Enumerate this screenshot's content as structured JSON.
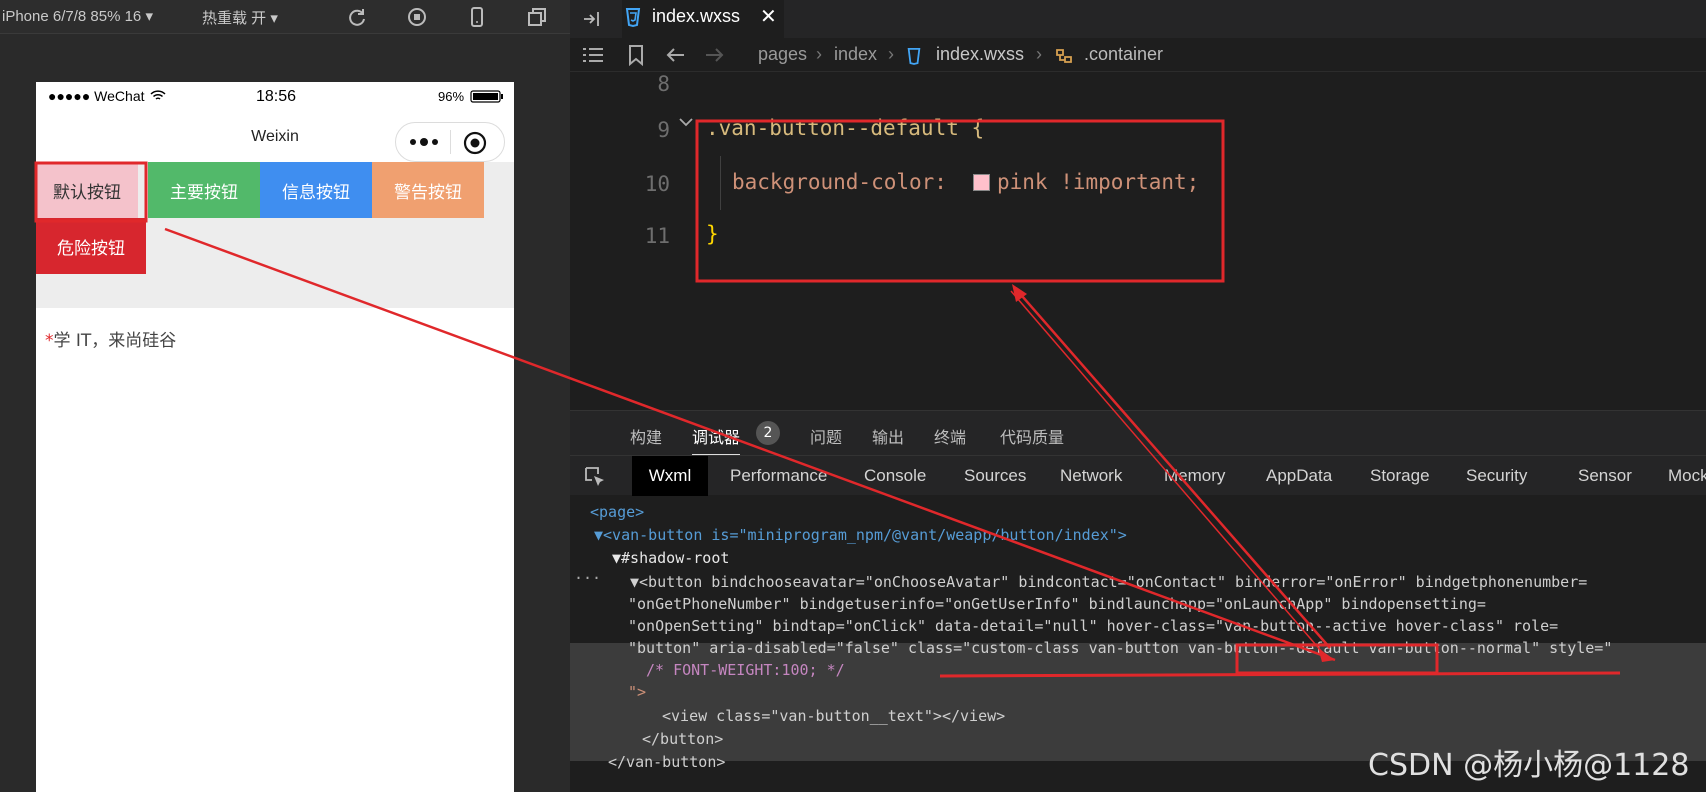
{
  "simulator": {
    "device_label": "iPhone 6/7/8 85% 16 ▾",
    "hot_reload_label": "热重载 开 ▾",
    "status": {
      "carrier": "●●●●● WeChat",
      "time": "18:56",
      "battery": "96%"
    },
    "nav_title": "Weixin",
    "buttons": [
      {
        "label": "默认按钮",
        "color": "#f4c2cb",
        "text_color": "#333333"
      },
      {
        "label": "主要按钮",
        "color": "#52b96a",
        "text_color": "#ffffff"
      },
      {
        "label": "信息按钮",
        "color": "#3f8ef0",
        "text_color": "#ffffff"
      },
      {
        "label": "警告按钮",
        "color": "#f0a070",
        "text_color": "#ffffff"
      },
      {
        "label": "危险按钮",
        "color": "#d7262e",
        "text_color": "#ffffff"
      }
    ],
    "note": {
      "asterisk": "*",
      "text": "学 IT，来尚硅谷"
    }
  },
  "editor": {
    "tab_label": "index.wxss",
    "breadcrumb": [
      "pages",
      "index",
      "index.wxss",
      ".container"
    ],
    "lines": [
      {
        "num": "8",
        "text": ""
      },
      {
        "num": "9",
        "text": ".van-button--default {"
      },
      {
        "num": "10",
        "text": "background-color: ",
        "value": "pink !important;"
      },
      {
        "num": "11",
        "text": "}"
      }
    ]
  },
  "panel_tabs": {
    "build": "构建",
    "debugger": "调试器",
    "badge": "2",
    "problems": "问题",
    "output": "输出",
    "terminal": "终端",
    "code_quality": "代码质量"
  },
  "devtools_tabs": [
    "Wxml",
    "Performance",
    "Console",
    "Sources",
    "Network",
    "Memory",
    "AppData",
    "Storage",
    "Security",
    "Sensor",
    "Mock"
  ],
  "wxml": {
    "l1": "<page>",
    "l2": "▼<van-button is=\"miniprogram_npm/@vant/weapp/button/index\">",
    "l3": "▼#shadow-root",
    "l4": "▼<button bindchooseavatar=\"onChooseAvatar\" bindcontact=\"onContact\" binderror=\"onError\" bindgetphonenumber=",
    "l5": "\"onGetPhoneNumber\" bindgetuserinfo=\"onGetUserInfo\" bindlaunchapp=\"onLaunchApp\" bindopensetting=",
    "l6": "\"onOpenSetting\" bindtap=\"onClick\" data-detail=\"null\" hover-class=\"van-button--active hover-class\" role=",
    "l7": "\"button\" aria-disabled=\"false\" class=\"custom-class van-button van-button--default van-button--normal\" style=\"",
    "l8": "/* FONT-WEIGHT:100; */",
    "l9": "\">",
    "l10": "<view class=\"van-button__text\"></view>",
    "l11": "</button>",
    "l12": "</van-button>",
    "ellipsis": "···"
  },
  "watermark": "CSDN @杨小杨@1128",
  "colors": {
    "annotation_red": "#e0282b",
    "pink_swatch": "#ffc0cb"
  }
}
